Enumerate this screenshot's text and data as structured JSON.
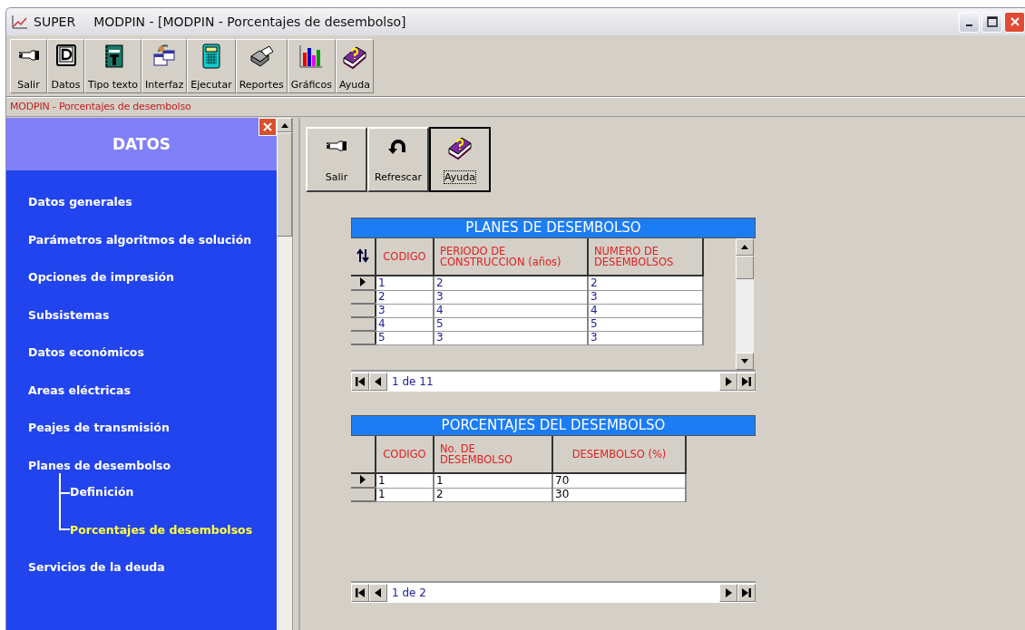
{
  "window": {
    "title_app": "SUPER",
    "title": "MODPIN - [MODPIN - Porcentajes de desembolso]"
  },
  "toolbar": [
    {
      "label": "Salir"
    },
    {
      "label": "Datos"
    },
    {
      "label": "Tipo texto"
    },
    {
      "label": "Interfaz"
    },
    {
      "label": "Ejecutar"
    },
    {
      "label": "Reportes"
    },
    {
      "label": "Gráficos"
    },
    {
      "label": "Ayuda"
    }
  ],
  "breadcrumb": "MODPIN - Porcentajes de desembolso",
  "sidebar": {
    "title": "DATOS",
    "items": [
      {
        "label": "Datos generales",
        "selected": false
      },
      {
        "label": "Parámetros algoritmos de solución",
        "selected": false
      },
      {
        "label": "Opciones de impresión",
        "selected": false
      },
      {
        "label": "Subsistemas",
        "selected": false
      },
      {
        "label": "Datos económicos",
        "selected": false
      },
      {
        "label": "Areas eléctricas",
        "selected": false
      },
      {
        "label": "Peajes de transmisión",
        "selected": false
      },
      {
        "label": "Planes de desembolso",
        "selected": false,
        "children": [
          {
            "label": "Definición",
            "selected": false
          },
          {
            "label": "Porcentajes de desembolsos",
            "selected": true
          }
        ]
      },
      {
        "label": "Servicios de la deuda",
        "selected": false
      }
    ]
  },
  "form_buttons": [
    {
      "label": "Salir",
      "focused": false
    },
    {
      "label": "Refrescar",
      "focused": false
    },
    {
      "label": "Ayuda",
      "focused": true
    }
  ],
  "grids": [
    {
      "title": "PLANES DE DESEMBOLSO",
      "sort_icon": true,
      "scrollbar": true,
      "columns": [
        "CODIGO",
        "PERIODO DE CONSTRUCCION (años)",
        "NUMERO DE DESEMBOLSOS"
      ],
      "rows": [
        {
          "cells": [
            "1",
            "2",
            "2"
          ],
          "selected": true
        },
        {
          "cells": [
            "2",
            "3",
            "3"
          ],
          "selected": false
        },
        {
          "cells": [
            "3",
            "4",
            "4"
          ],
          "selected": false
        },
        {
          "cells": [
            "4",
            "5",
            "5"
          ],
          "selected": false
        },
        {
          "cells": [
            "5",
            "3",
            "3"
          ],
          "selected": false
        }
      ],
      "navigator": "1 de 11"
    },
    {
      "title": "PORCENTAJES DEL DESEMBOLSO",
      "sort_icon": false,
      "scrollbar": false,
      "columns": [
        "CODIGO",
        "No. DE DESEMBOLSO",
        "DESEMBOLSO (%)"
      ],
      "rows": [
        {
          "cells": [
            "1",
            "1",
            "70"
          ],
          "selected": true
        },
        {
          "cells": [
            "1",
            "2",
            "30"
          ],
          "selected": false
        }
      ],
      "navigator": "1 de 2"
    }
  ]
}
